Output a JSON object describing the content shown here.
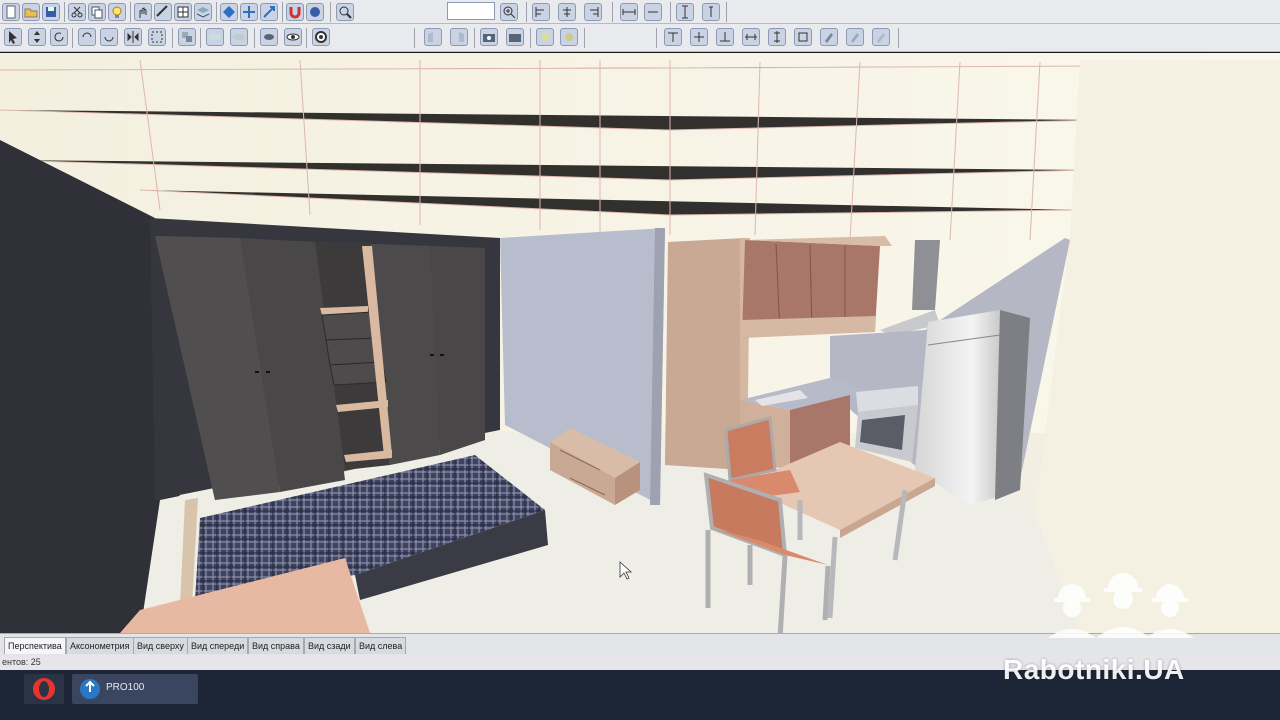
{
  "toolbar": {
    "zoom_value": "",
    "top_icons": [
      "new-file-icon",
      "open-folder-icon",
      "save-icon",
      "cut-icon",
      "copy-icon",
      "lightbulb-icon",
      "hand-pan-icon",
      "measure-icon",
      "grid-icon",
      "layers-icon",
      "diamond-icon",
      "move-icon",
      "scale-icon",
      "magnet-icon",
      "snap-icon",
      "zoom-out-icon",
      "zoom-in-icon",
      "align-left-icon",
      "align-center-icon",
      "align-right-icon",
      "distribute-h-icon",
      "distribute-v-icon"
    ],
    "second_icons": [
      "cursor-icon",
      "rotate-icon",
      "move-arrow-icon",
      "undo-icon",
      "redo-icon",
      "mirror-icon",
      "select-all-icon",
      "group-icon",
      "texture-icon",
      "render-icon",
      "shadow-icon",
      "eye-icon",
      "camera-icon",
      "target-icon"
    ]
  },
  "view_tabs": [
    {
      "label": "Перспектива",
      "active": true
    },
    {
      "label": "Аксонометрия",
      "active": false
    },
    {
      "label": "Вид сверху",
      "active": false
    },
    {
      "label": "Вид спереди",
      "active": false
    },
    {
      "label": "Вид справа",
      "active": false
    },
    {
      "label": "Вид сзади",
      "active": false
    },
    {
      "label": "Вид слева",
      "active": false
    }
  ],
  "status": {
    "text": "ентов: 25"
  },
  "taskbar": {
    "app_label": "PRO100",
    "browser_icon": "opera-icon",
    "app_icon": "pro100-icon"
  },
  "watermark": {
    "text": "Rabotniki.UA",
    "icon": "workers-helmet-icon"
  },
  "colors": {
    "wall_dark": "#3a3b42",
    "floor": "#efeee6",
    "wardrobe": "#4e4c4d",
    "kitchen_wood": "#c9a894",
    "chair_seat": "#c87a5e",
    "bed_plaid": "#3b3f58"
  }
}
